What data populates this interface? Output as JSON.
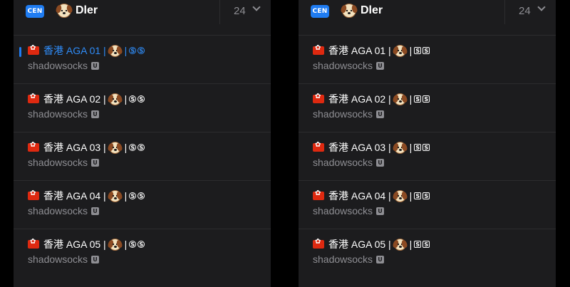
{
  "panels": [
    {
      "badge": "CEN",
      "title": "Dler",
      "count": "24",
      "nodes": [
        {
          "name": "香港 AGA 01 |",
          "tags": [
            "S",
            "S"
          ],
          "proto": "shadowsocks",
          "proto_badge": "U",
          "selected": true
        },
        {
          "name": "香港 AGA 02 |",
          "tags": [
            "S",
            "S"
          ],
          "proto": "shadowsocks",
          "proto_badge": "U"
        },
        {
          "name": "香港 AGA 03 |",
          "tags": [
            "S",
            "S"
          ],
          "proto": "shadowsocks",
          "proto_badge": "U"
        },
        {
          "name": "香港 AGA 04 |",
          "tags": [
            "S",
            "S"
          ],
          "proto": "shadowsocks",
          "proto_badge": "U"
        },
        {
          "name": "香港 AGA 05 |",
          "tags": [
            "S",
            "S"
          ],
          "proto": "shadowsocks",
          "proto_badge": "U"
        }
      ]
    },
    {
      "badge": "CEN",
      "title": "Dler",
      "count": "24",
      "nodes": [
        {
          "name": "香港 AGA 01 |",
          "tags": [
            "S",
            "S"
          ],
          "proto": "shadowsocks",
          "proto_badge": "U"
        },
        {
          "name": "香港 AGA 02 |",
          "tags": [
            "S",
            "S"
          ],
          "proto": "shadowsocks",
          "proto_badge": "U"
        },
        {
          "name": "香港 AGA 03 |",
          "tags": [
            "S",
            "S"
          ],
          "proto": "shadowsocks",
          "proto_badge": "U"
        },
        {
          "name": "香港 AGA 04 |",
          "tags": [
            "S",
            "S"
          ],
          "proto": "shadowsocks",
          "proto_badge": "U"
        },
        {
          "name": "香港 AGA 05 |",
          "tags": [
            "S",
            "S"
          ],
          "proto": "shadowsocks",
          "proto_badge": "U"
        }
      ]
    }
  ],
  "colors": {
    "accent": "#1f7cf2",
    "selected_text": "#2f8cf8",
    "panel_bg": "#1c1c1e",
    "secondary_text": "#8e8e93"
  },
  "icons": {
    "header_logo": "dog-face-icon",
    "node_flag": "hong-kong-flag-icon",
    "node_emoji": "dog-face-icon",
    "collapse": "chevron-down-icon"
  }
}
